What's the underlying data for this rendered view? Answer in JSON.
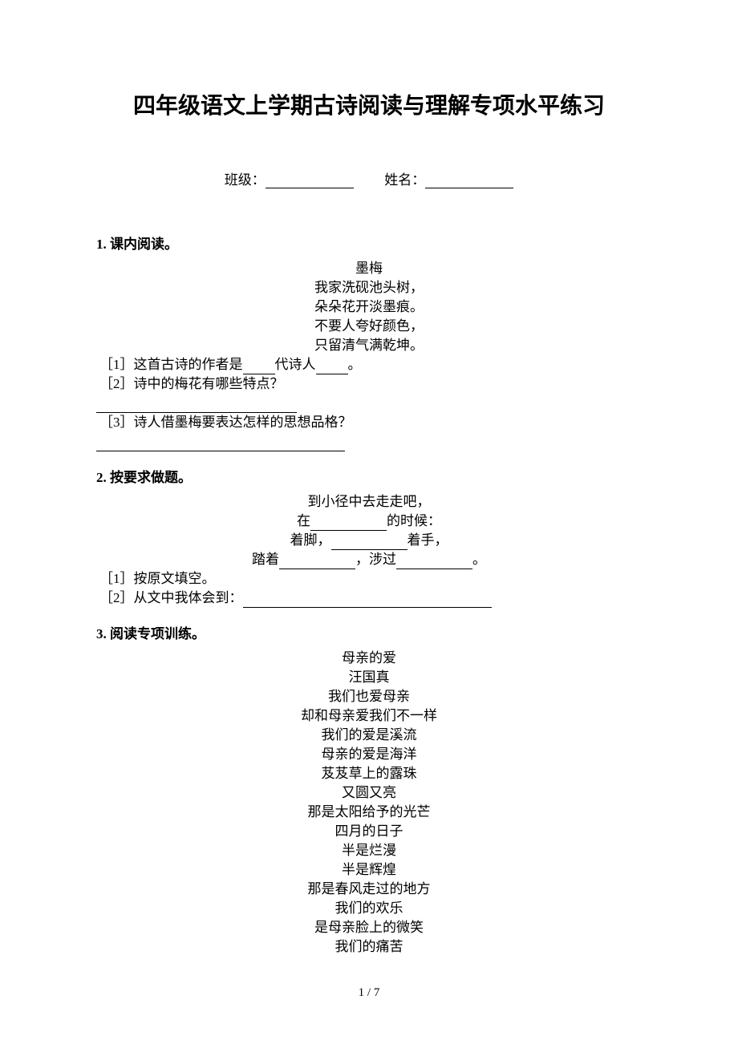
{
  "title": "四年级语文上学期古诗阅读与理解专项水平练习",
  "info": {
    "class_label": "班级：",
    "name_label": "姓名："
  },
  "section1": {
    "heading": "1.  课内阅读。",
    "poem_title": "墨梅",
    "lines": [
      "我家洗砚池头树，",
      "朵朵花开淡墨痕。",
      "不要人夸好颜色，",
      "只留清气满乾坤。"
    ],
    "q1_prefix": "［1］这首古诗的作者是",
    "q1_mid": "代诗人",
    "q1_suffix": "。",
    "q2": "［2］诗中的梅花有哪些特点？",
    "q3": "［3］诗人借墨梅要表达怎样的思想品格？"
  },
  "section2": {
    "heading": "2.  按要求做题。",
    "line1": "到小径中去走走吧，",
    "line2_prefix": "在",
    "line2_suffix": "的时候：",
    "line3_prefix": "着脚，",
    "line3_suffix": "着手，",
    "line4_prefix": "踏着",
    "line4_mid": "，涉过",
    "line4_suffix": "。",
    "q1": "［1］按原文填空。",
    "q2_prefix": "［2］从文中我体会到："
  },
  "section3": {
    "heading": "3.  阅读专项训练。",
    "poem_title": "母亲的爱",
    "author": "汪国真",
    "lines": [
      "我们也爱母亲",
      "却和母亲爱我们不一样",
      "我们的爱是溪流",
      "母亲的爱是海洋",
      "芨芨草上的露珠",
      "又圆又亮",
      "那是太阳给予的光芒",
      "四月的日子",
      "半是烂漫",
      "半是辉煌",
      "那是春风走过的地方",
      "我们的欢乐",
      "是母亲脸上的微笑",
      "我们的痛苦"
    ]
  },
  "pagination": "1 / 7"
}
